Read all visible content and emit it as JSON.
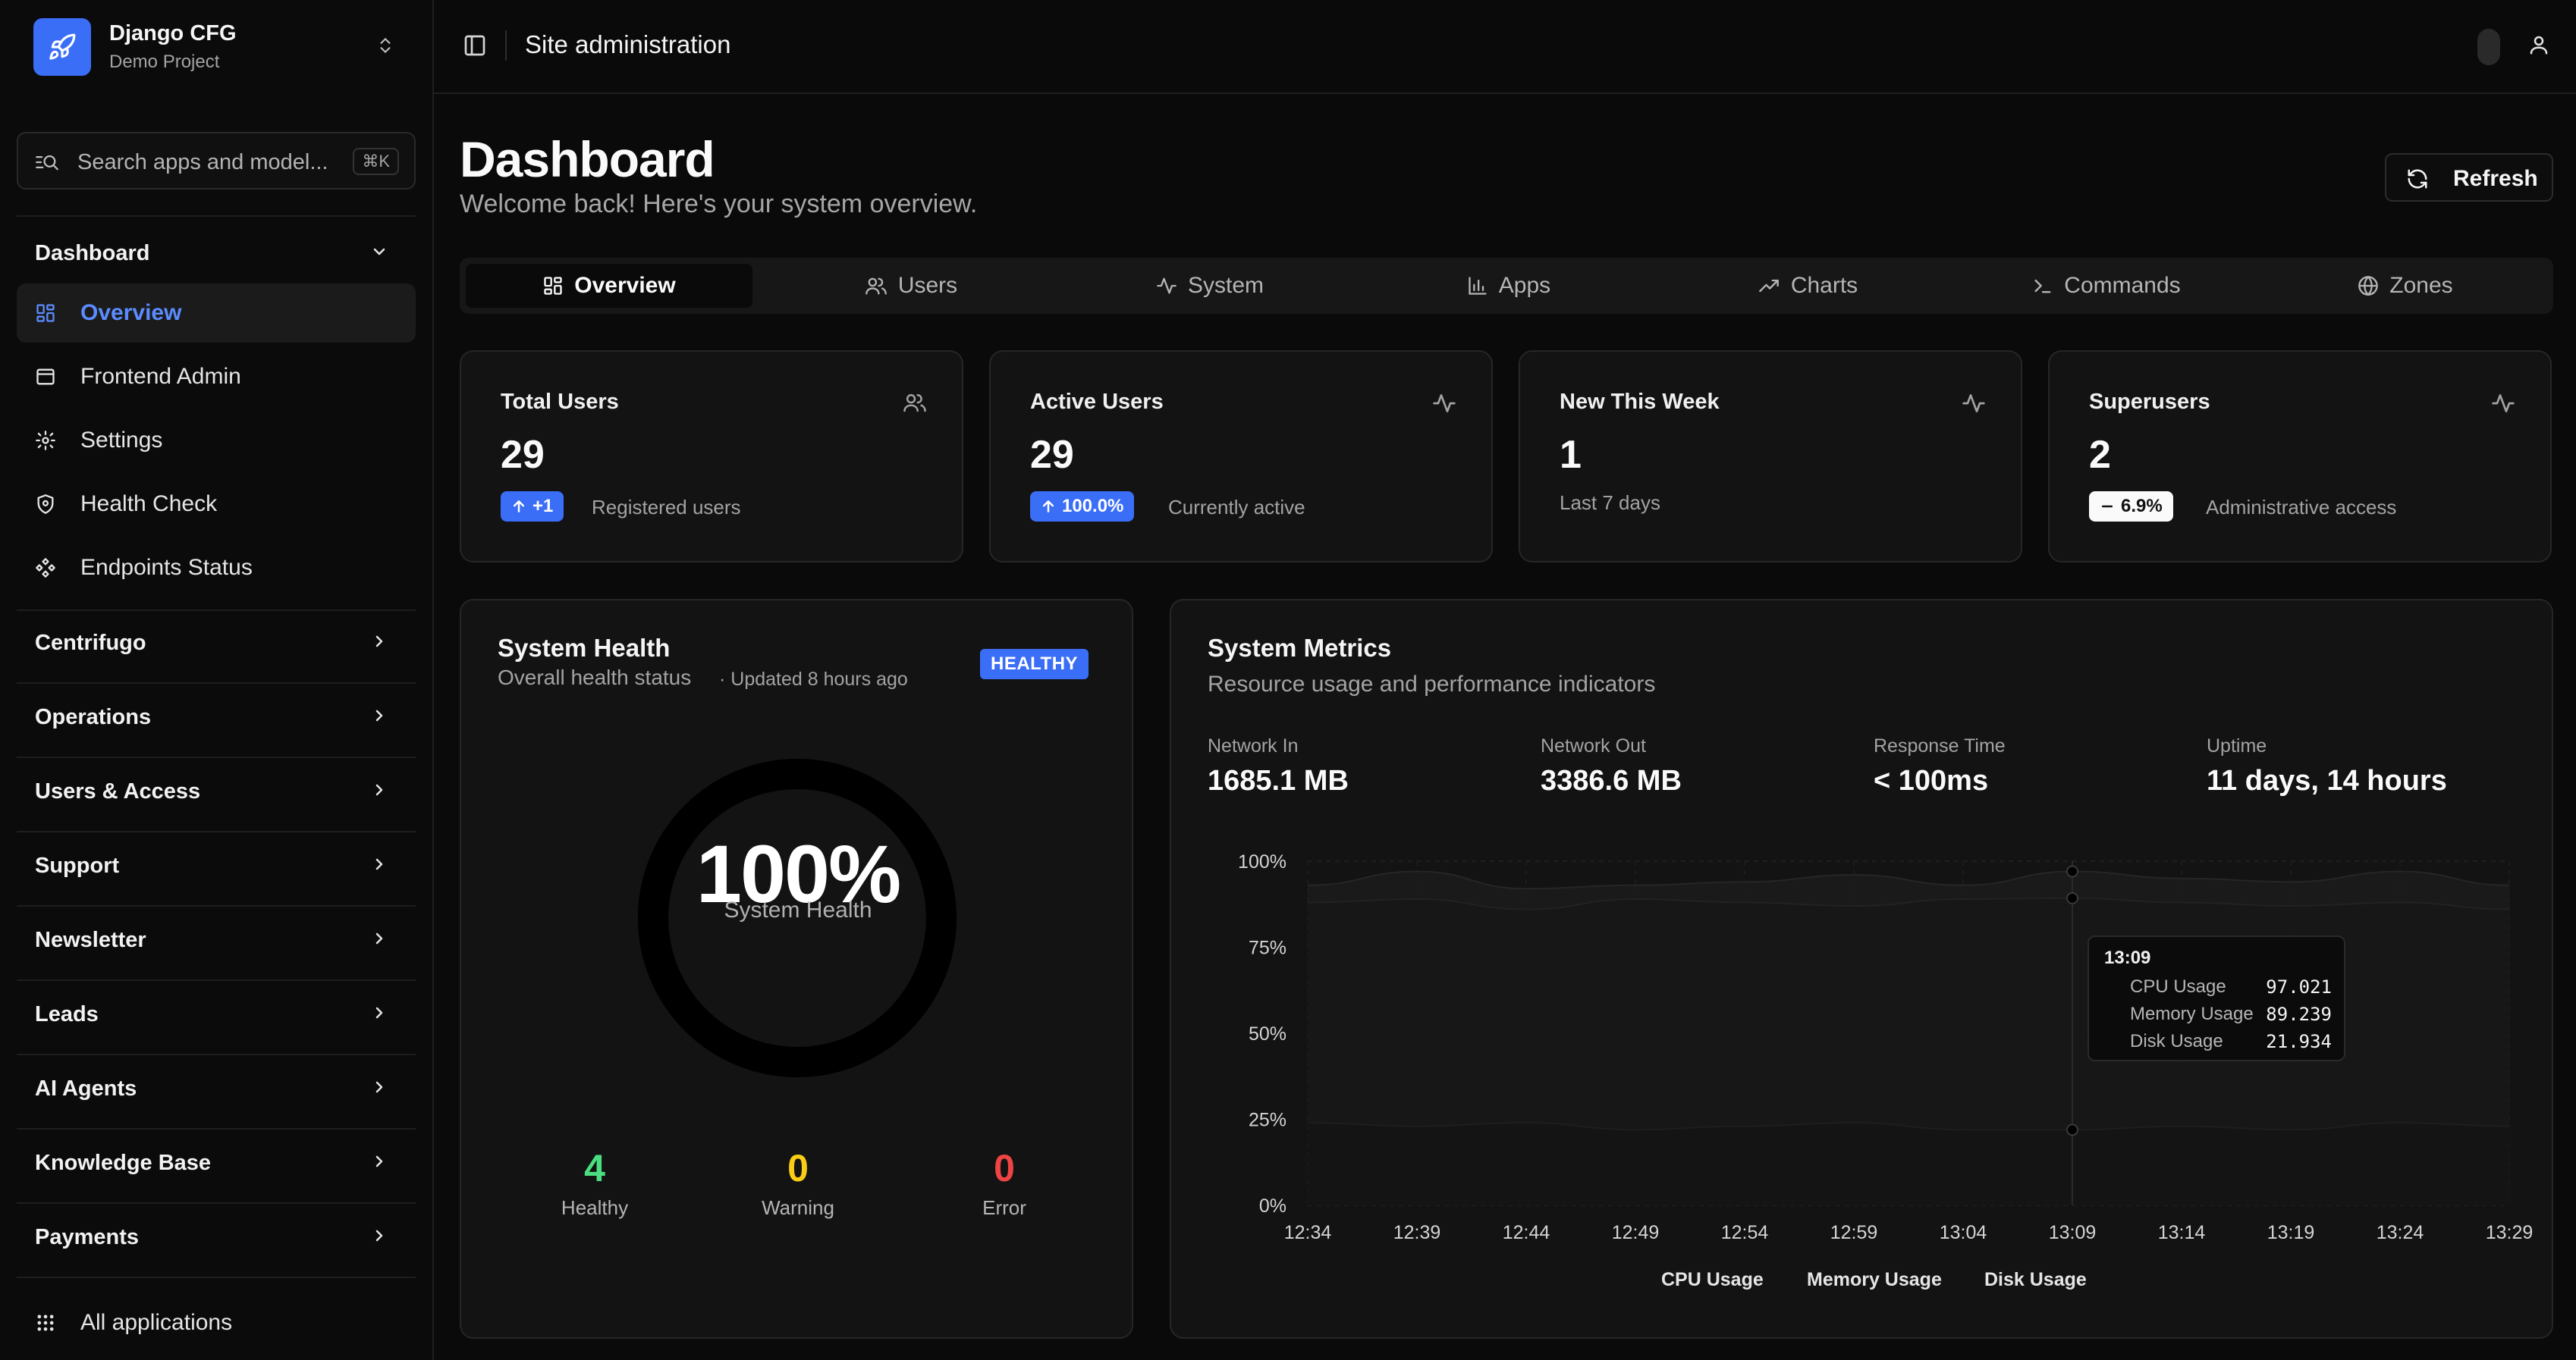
{
  "brand": {
    "name": "Django CFG",
    "project": "Demo Project"
  },
  "search": {
    "placeholder": "Search apps and model...",
    "shortcut": "⌘K"
  },
  "sidebar": {
    "dashboard_group": "Dashboard",
    "items": [
      {
        "label": "Overview",
        "icon": "dashboard-icon",
        "active": true
      },
      {
        "label": "Frontend Admin",
        "icon": "window-icon"
      },
      {
        "label": "Settings",
        "icon": "gear-icon"
      },
      {
        "label": "Health Check",
        "icon": "shield-icon"
      },
      {
        "label": "Endpoints Status",
        "icon": "endpoints-icon"
      }
    ],
    "groups": [
      "Centrifugo",
      "Operations",
      "Users & Access",
      "Support",
      "Newsletter",
      "Leads",
      "AI Agents",
      "Knowledge Base",
      "Payments"
    ],
    "all_apps": "All applications"
  },
  "topbar": {
    "title": "Site administration"
  },
  "header": {
    "title": "Dashboard",
    "subtitle": "Welcome back! Here's your system overview.",
    "refresh": "Refresh"
  },
  "tabs": [
    {
      "label": "Overview",
      "icon": "grid-icon",
      "active": true
    },
    {
      "label": "Users",
      "icon": "users-icon"
    },
    {
      "label": "System",
      "icon": "activity-icon"
    },
    {
      "label": "Apps",
      "icon": "bar-chart-icon"
    },
    {
      "label": "Charts",
      "icon": "trending-up-icon"
    },
    {
      "label": "Commands",
      "icon": "terminal-icon"
    },
    {
      "label": "Zones",
      "icon": "globe-icon"
    }
  ],
  "stats": [
    {
      "title": "Total Users",
      "value": "29",
      "badge": "+1",
      "badge_icon": "arrow-up",
      "desc": "Registered users",
      "icon": "users-icon"
    },
    {
      "title": "Active Users",
      "value": "29",
      "badge": "100.0%",
      "badge_icon": "arrow-up",
      "desc": "Currently active",
      "icon": "activity-icon"
    },
    {
      "title": "New This Week",
      "value": "1",
      "desc": "Last 7 days",
      "icon": "activity-icon"
    },
    {
      "title": "Superusers",
      "value": "2",
      "badge": "6.9%",
      "badge_icon": "dash",
      "desc": "Administrative access",
      "icon": "activity-icon"
    }
  ],
  "health": {
    "title": "System Health",
    "subtitle": "Overall health status",
    "updated": "· Updated 8 hours ago",
    "badge": "HEALTHY",
    "percent": "100%",
    "percent_value": 100,
    "gauge_label": "System Health",
    "counts": [
      {
        "num": "4",
        "label": "Healthy",
        "color": "#4ade80"
      },
      {
        "num": "0",
        "label": "Warning",
        "color": "#facc15"
      },
      {
        "num": "0",
        "label": "Error",
        "color": "#ef4444"
      }
    ]
  },
  "metrics": {
    "title": "System Metrics",
    "subtitle": "Resource usage and performance indicators",
    "kpis": [
      {
        "label": "Network In",
        "value": "1685.1 MB"
      },
      {
        "label": "Network Out",
        "value": "3386.6 MB"
      },
      {
        "label": "Response Time",
        "value": "< 100ms"
      },
      {
        "label": "Uptime",
        "value": "11 days, 14 hours"
      }
    ],
    "tooltip": {
      "time": "13:09",
      "rows": [
        {
          "label": "CPU Usage",
          "value": "97.021"
        },
        {
          "label": "Memory Usage",
          "value": "89.239"
        },
        {
          "label": "Disk Usage",
          "value": "21.934"
        }
      ]
    }
  },
  "chart_data": {
    "type": "area",
    "x": [
      "12:34",
      "12:39",
      "12:44",
      "12:49",
      "12:54",
      "12:59",
      "13:04",
      "13:09",
      "13:14",
      "13:19",
      "13:24",
      "13:29"
    ],
    "yticks": [
      "100%",
      "75%",
      "50%",
      "25%",
      "0%"
    ],
    "ylim": [
      0,
      100
    ],
    "series": [
      {
        "name": "CPU Usage",
        "values": [
          93,
          97,
          92,
          93,
          94,
          96,
          93,
          97.021,
          95,
          94,
          97,
          93
        ]
      },
      {
        "name": "Memory Usage",
        "values": [
          88,
          89,
          86,
          89,
          88,
          87,
          89,
          89.239,
          88,
          87,
          88,
          86
        ]
      },
      {
        "name": "Disk Usage",
        "values": [
          24,
          23,
          24,
          22,
          23,
          24,
          22,
          21.934,
          23,
          22,
          24,
          23
        ]
      }
    ],
    "legend_position": "bottom",
    "grid": true
  }
}
